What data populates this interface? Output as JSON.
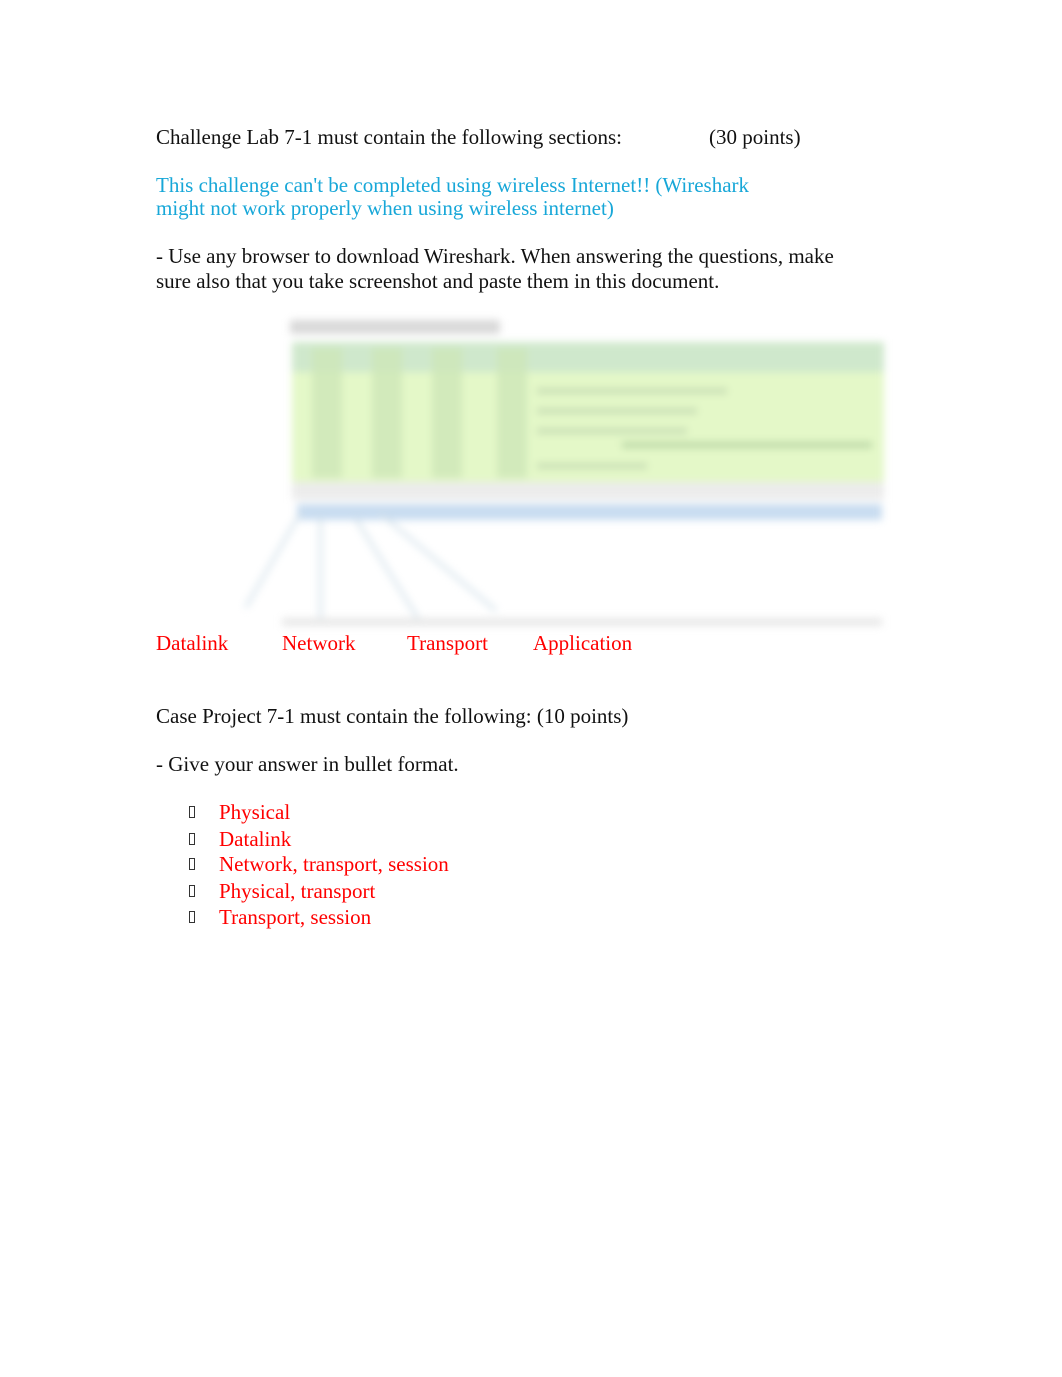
{
  "challenge": {
    "heading": "Challenge Lab 7-1 must contain the following sections:",
    "points": "(30 points)",
    "warning_line1": "This challenge can't be completed using wireless Internet!! (Wireshark",
    "warning_line2": "might not work properly when using wireless internet)",
    "instruction_line1": "- Use any browser to download Wireshark. When answering the questions, make",
    "instruction_line2": "sure also that you take screenshot and paste them in this document.",
    "screenshot_icon": "blurred-wireshark-screenshot",
    "layer_labels": [
      "Datalink",
      "Network",
      "Transport",
      "Application"
    ]
  },
  "case_project": {
    "heading": "Case Project 7-1 must contain the following: (10 points)",
    "instruction": "- Give your answer in bullet format.",
    "bullet_icon": "missing-glyph-box",
    "answers": [
      "Physical",
      "Datalink",
      "Network, transport, session",
      "Physical, transport",
      "Transport, session"
    ]
  },
  "colors": {
    "warning": "#17a7d8",
    "answer": "#ff0000",
    "body_text": "#111111"
  }
}
